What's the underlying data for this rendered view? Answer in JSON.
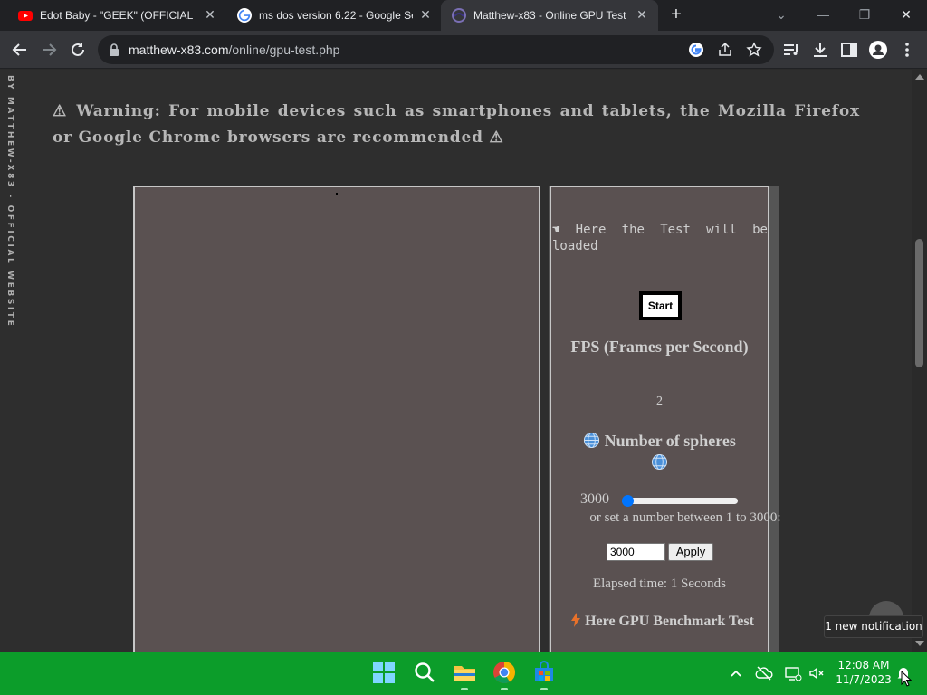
{
  "tabs": [
    {
      "title": "Edot Baby - \"GEEK\" (OFFICIAL M",
      "icon": "youtube-icon"
    },
    {
      "title": "ms dos version 6.22 - Google Se",
      "icon": "google-icon"
    },
    {
      "title": "Matthew-x83 - Online GPU Test",
      "icon": "site-favicon-icon",
      "active": true
    }
  ],
  "omnibox": {
    "host": "matthew-x83.com",
    "path": "/online/gpu-test.php"
  },
  "page": {
    "side_text": "BY MATTHEW-X83 - OFFICIAL WEBSITE",
    "warning": "⚠ Warning: For mobile devices such as smartphones and tablets, the Mozilla Firefox or Google Chrome browsers are recommended ⚠",
    "panel": {
      "loaded_text": "☚ Here the Test will be loaded",
      "start_label": "Start",
      "fps_heading": "FPS (Frames per Second)",
      "fps_value": "2",
      "spheres_heading": "Number of spheres",
      "slider_value": "3000",
      "slider_fraction": 0.0,
      "set_text": "or set a number between 1 to 3000:",
      "input_value": "3000",
      "apply_label": "Apply",
      "elapsed_text": "Elapsed time: 1 Seconds",
      "benchmark_heading": "Here GPU Benchmark Test"
    }
  },
  "taskbar": {
    "time": "12:08 AM",
    "date": "11/7/2023"
  },
  "notification": {
    "text": "1 new notification"
  },
  "colors": {
    "taskbar": "#0c9d2a",
    "chrome_dark": "#202124",
    "toolbar": "#35363a",
    "slider_accent": "#0075ff"
  }
}
